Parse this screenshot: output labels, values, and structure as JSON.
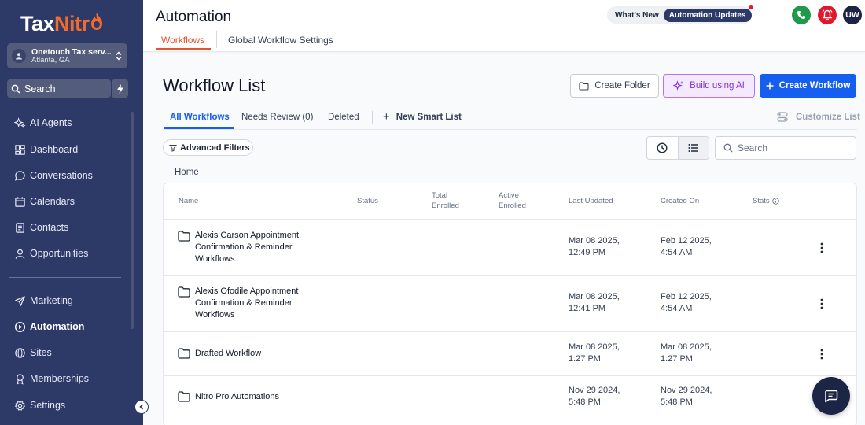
{
  "brand": {
    "name_part1": "Tax",
    "name_part2": "Nitr",
    "accent": "#f26b2c",
    "sidebar_bg": "#2d3a68"
  },
  "account": {
    "name": "Onetouch Tax serv...",
    "location": "Atlanta, GA"
  },
  "sidebar": {
    "search_label": "Search",
    "items": [
      {
        "label": "AI Agents",
        "icon": "sparkle-icon"
      },
      {
        "label": "Dashboard",
        "icon": "dashboard-icon"
      },
      {
        "label": "Conversations",
        "icon": "chat-icon"
      },
      {
        "label": "Calendars",
        "icon": "calendar-icon"
      },
      {
        "label": "Contacts",
        "icon": "contacts-icon"
      },
      {
        "label": "Opportunities",
        "icon": "person-icon"
      },
      {
        "label": "Marketing",
        "icon": "send-icon"
      },
      {
        "label": "Automation",
        "icon": "play-icon",
        "active": true
      },
      {
        "label": "Sites",
        "icon": "globe-icon"
      },
      {
        "label": "Memberships",
        "icon": "medal-icon"
      },
      {
        "label": "Settings",
        "icon": "gear-icon"
      }
    ]
  },
  "header": {
    "title": "Automation",
    "tabs": [
      {
        "label": "Workflows",
        "active": true
      },
      {
        "label": "Global Workflow Settings"
      }
    ],
    "whats_new": "What's New",
    "updates": "Automation Updates",
    "user_initials": "UW"
  },
  "main": {
    "title": "Workflow List",
    "buttons": {
      "create_folder": "Create Folder",
      "build_ai": "Build using AI",
      "create_workflow": "Create Workflow"
    },
    "list_tabs": {
      "all": "All Workflows",
      "review": "Needs Review (0)",
      "deleted": "Deleted",
      "new_smart": "New Smart List",
      "customize": "Customize List"
    },
    "advanced_filters": "Advanced Filters",
    "search_placeholder": "Search",
    "breadcrumb": "Home"
  },
  "table": {
    "columns": {
      "name": "Name",
      "status": "Status",
      "total_enrolled": "Total\nEnrolled",
      "active_enrolled": "Active\nEnrolled",
      "last_updated": "Last Updated",
      "created_on": "Created On",
      "stats": "Stats"
    },
    "rows": [
      {
        "name": "Alexis Carson Appointment\nConfirmation & Reminder\nWorkflows",
        "last_updated": "Mar 08 2025,\n12:49 PM",
        "created_on": "Feb 12 2025,\n4:54 AM"
      },
      {
        "name": "Alexis Ofodile Appointment\nConfirmation & Reminder\nWorkflows",
        "last_updated": "Mar 08 2025,\n12:41 PM",
        "created_on": "Feb 12 2025,\n4:54 AM"
      },
      {
        "name": "Drafted Workflow",
        "last_updated": "Mar 08 2025,\n1:27 PM",
        "created_on": "Mar 08 2025,\n1:27 PM"
      },
      {
        "name": "Nitro Pro Automations",
        "last_updated": "Nov 29 2024,\n5:48 PM",
        "created_on": "Nov 29 2024,\n5:48 PM"
      }
    ]
  }
}
